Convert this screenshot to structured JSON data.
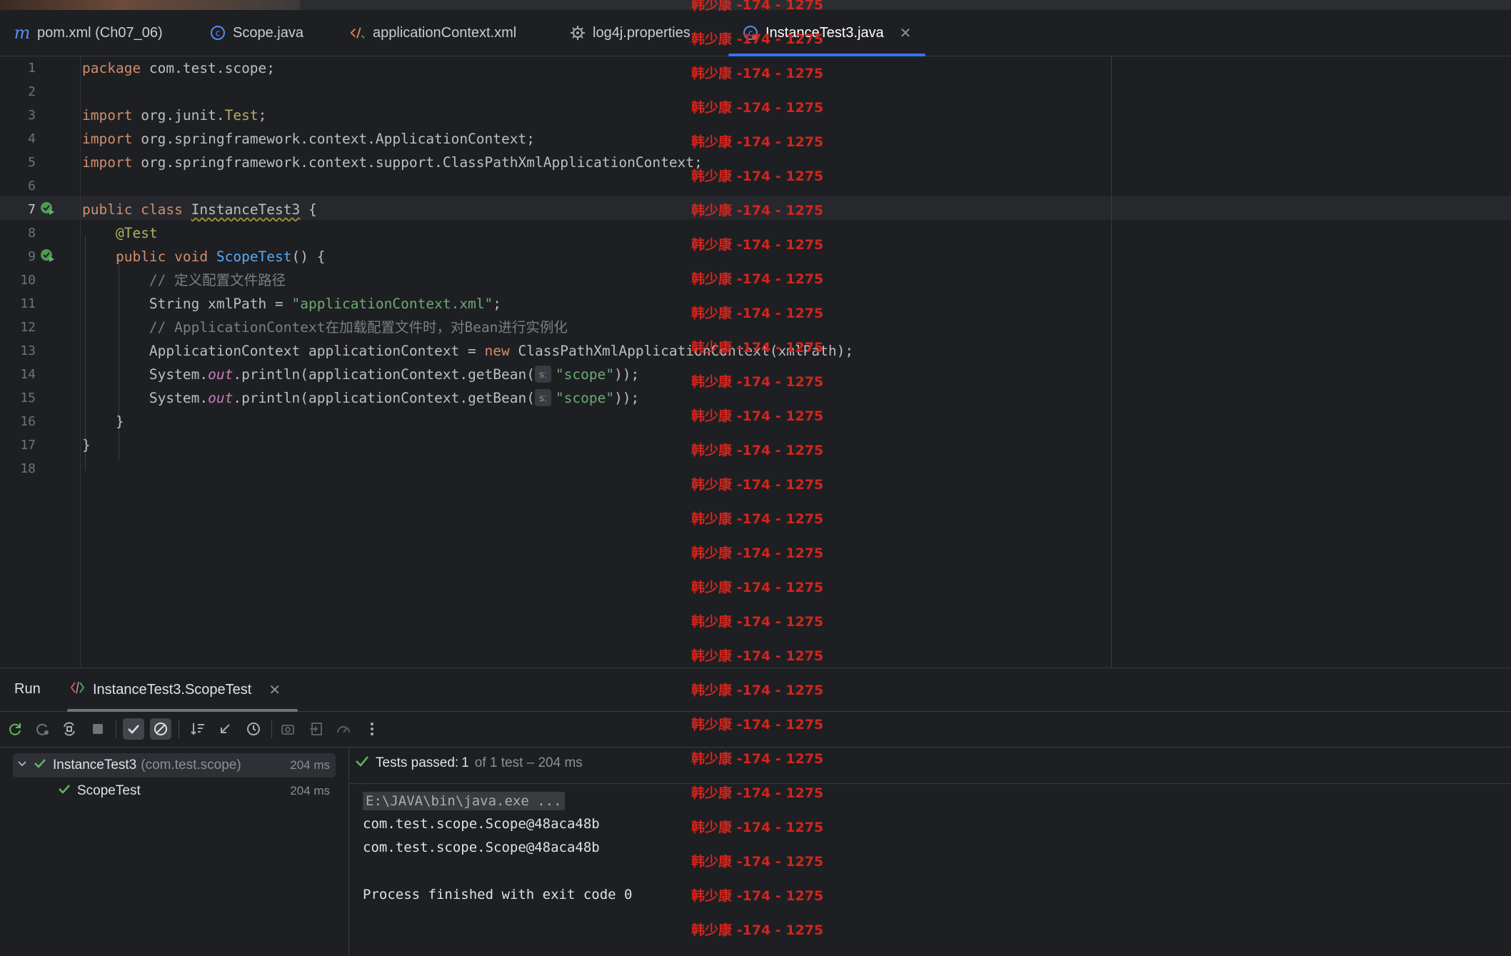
{
  "tabs": [
    {
      "label": "pom.xml (Ch07_06)",
      "icon": "maven-icon"
    },
    {
      "label": "Scope.java",
      "icon": "java-class-icon"
    },
    {
      "label": "applicationContext.xml",
      "icon": "xml-icon"
    },
    {
      "label": "log4j.properties",
      "icon": "gear-icon"
    },
    {
      "label": "InstanceTest3.java",
      "icon": "java-class-icon",
      "active": true
    }
  ],
  "editor": {
    "line_numbers": [
      "1",
      "2",
      "3",
      "4",
      "5",
      "6",
      "7",
      "8",
      "9",
      "10",
      "11",
      "12",
      "13",
      "14",
      "15",
      "16",
      "17",
      "18"
    ],
    "current_line": 7
  },
  "code": {
    "l1": {
      "kw": "package",
      "rest": " com.test.scope;"
    },
    "l3": {
      "kw": "import",
      "rest": " org.junit.",
      "ann": "Test",
      "end": ";"
    },
    "l4": {
      "kw": "import",
      "rest": " org.springframework.context.ApplicationContext;"
    },
    "l5": {
      "kw": "import",
      "rest": " org.springframework.context.support.ClassPathXmlApplicationContext;"
    },
    "l7": {
      "kw": "public class",
      "cls": "InstanceTest3",
      "end": " {"
    },
    "l8": {
      "ann": "@Test"
    },
    "l9": {
      "kw": "public void",
      "fn": "ScopeTest",
      "end": "() {"
    },
    "l10": {
      "cmt": "// 定义配置文件路径"
    },
    "l11": {
      "pre": "String xmlPath = ",
      "str": "\"applicationContext.xml\"",
      "end": ";"
    },
    "l12": {
      "cmt": "// ApplicationContext在加载配置文件时，对Bean进行实例化"
    },
    "l13": {
      "pre": "ApplicationContext applicationContext = ",
      "kw": "new",
      "end": " ClassPathXmlApplicationContext(xmlPath);"
    },
    "l14": {
      "pre": "System.",
      "ital": "out",
      "mid": ".println(applicationContext.getBean(",
      "hint": "s:",
      "str": "\"scope\"",
      "end": "));"
    },
    "l15": {
      "pre": "System.",
      "ital": "out",
      "mid": ".println(applicationContext.getBean(",
      "hint": "s:",
      "str": "\"scope\"",
      "end": "));"
    },
    "l16": {
      "text": "}"
    },
    "l17": {
      "text": "}"
    }
  },
  "run": {
    "title": "Run",
    "tab_label": "InstanceTest3.ScopeTest",
    "tree": [
      {
        "name": "InstanceTest3",
        "pkg": "(com.test.scope)",
        "time": "204 ms"
      },
      {
        "name": "ScopeTest",
        "time": "204 ms"
      }
    ],
    "status": {
      "passed": "Tests passed:",
      "count": "1",
      "rest": "of 1 test – 204 ms"
    },
    "console": [
      "E:\\JAVA\\bin\\java.exe ...",
      "com.test.scope.Scope@48aca48b",
      "com.test.scope.Scope@48aca48b",
      "",
      "Process finished with exit code 0"
    ]
  },
  "watermark": "韩少康 -174 - 1275"
}
